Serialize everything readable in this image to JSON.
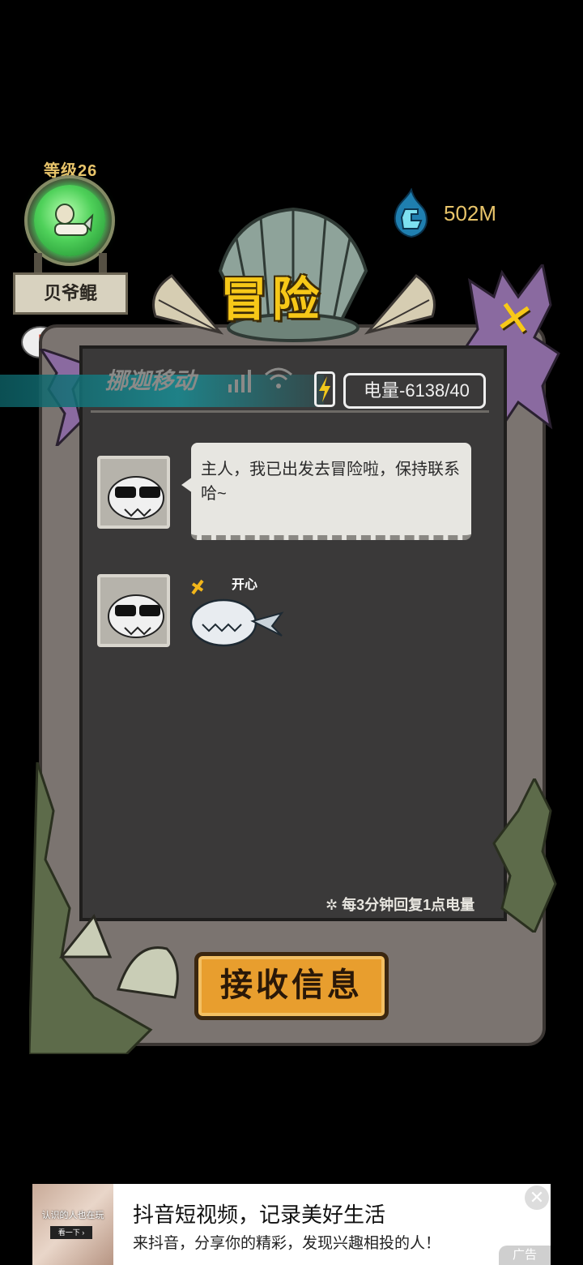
{
  "player": {
    "level_label": "等级26",
    "name": "贝爷鲲",
    "alert": "!"
  },
  "currency": {
    "amount": "502M",
    "icon": "gem-icon",
    "color": "#35a4c9"
  },
  "title": "冒险",
  "phone": {
    "carrier": "挪迦移动",
    "power_label": "电量-6138/40"
  },
  "chat": {
    "messages": [
      {
        "type": "text",
        "text": "主人，我已出发去冒险啦，保持联系哈~"
      },
      {
        "type": "sticker",
        "sticker_caption": "开心"
      }
    ]
  },
  "recovery_note": "每3分钟回复1点电量",
  "receive_button": "接收信息",
  "ad": {
    "thumb_caption": "认识的人也在玩",
    "thumb_button": "看一下 ›",
    "title": "抖音短视频，记录美好生活",
    "subtitle": "来抖音，分享你的精彩，发现兴趣相投的人！",
    "tag": "广告",
    "close": "✕"
  }
}
